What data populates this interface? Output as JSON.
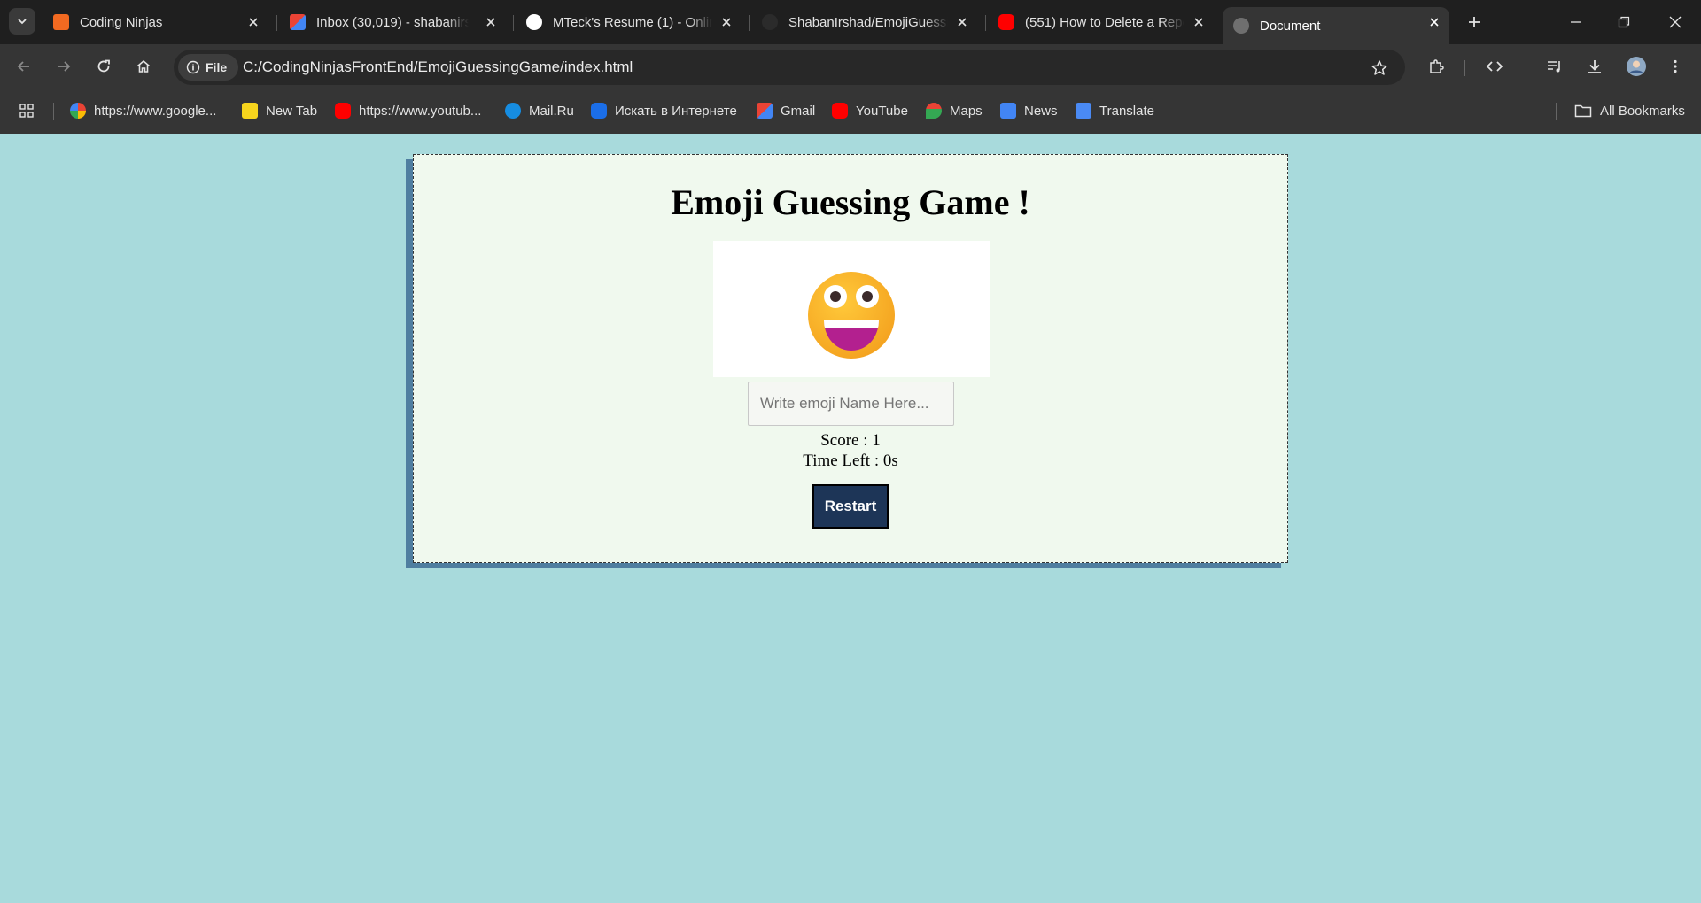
{
  "browser": {
    "tabs": [
      {
        "label": "Coding Ninjas",
        "icon": "coding-ninjas-favicon"
      },
      {
        "label": "Inbox (30,019) - shabanirshad",
        "icon": "gmail-favicon"
      },
      {
        "label": "MTeck's Resume (1) - Online",
        "icon": "resume-favicon"
      },
      {
        "label": "ShabanIrshad/EmojiGuessingGame",
        "icon": "github-favicon"
      },
      {
        "label": "(551) How to Delete a Repository",
        "icon": "youtube-favicon"
      },
      {
        "label": "Document",
        "icon": "globe-favicon",
        "active": true
      }
    ],
    "address_bar": {
      "chip_label": "File",
      "url": "C:/CodingNinjasFrontEnd/EmojiGuessingGame/index.html"
    },
    "bookmarks": [
      {
        "label": "https://www.google...",
        "icon": "google-icon"
      },
      {
        "label": "New Tab",
        "icon": "new-tab-icon"
      },
      {
        "label": "https://www.youtub...",
        "icon": "youtube-icon"
      },
      {
        "label": "Mail.Ru",
        "icon": "mailru-icon"
      },
      {
        "label": "Искать в Интернете",
        "icon": "search-icon"
      },
      {
        "label": "Gmail",
        "icon": "gmail-icon"
      },
      {
        "label": "YouTube",
        "icon": "youtube-icon"
      },
      {
        "label": "Maps",
        "icon": "maps-icon"
      },
      {
        "label": "News",
        "icon": "news-icon"
      },
      {
        "label": "Translate",
        "icon": "translate-icon"
      }
    ],
    "all_bookmarks_label": "All Bookmarks"
  },
  "game": {
    "title": "Emoji Guessing Game !",
    "emoji_icon": "grinning-face-with-big-eyes",
    "input_placeholder": "Write emoji Name Here...",
    "score_text": "Score : 1",
    "time_text": "Time Left : 0s",
    "restart_label": "Restart"
  },
  "colors": {
    "page_bg": "#a8dadc",
    "card_bg": "#f0f9ee",
    "card_shadow": "#4f7ea0",
    "button_bg": "#1d3557"
  }
}
